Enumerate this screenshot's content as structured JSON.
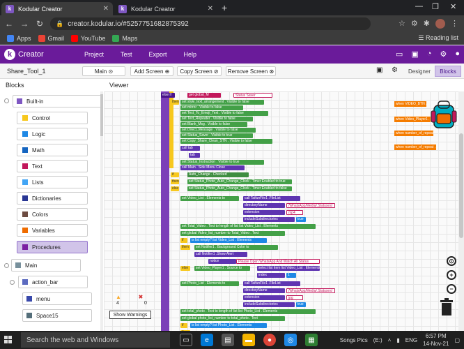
{
  "browser": {
    "tabs": [
      {
        "title": "Kodular Creator",
        "active": true
      },
      {
        "title": "Kodular Creator",
        "active": false
      }
    ],
    "url": "creator.kodular.io/#5257751682875392",
    "bookmarks": [
      {
        "label": "Apps",
        "color": "#4285f4"
      },
      {
        "label": "Gmail",
        "color": "#ea4335"
      },
      {
        "label": "YouTube",
        "color": "#ff0000"
      },
      {
        "label": "Maps",
        "color": "#34a853"
      }
    ],
    "reading_list": "Reading list"
  },
  "kodular": {
    "app_name": "Creator",
    "logo_letter": "k",
    "menu": [
      "Project",
      "Test",
      "Export",
      "Help"
    ],
    "header_color": "#6a1b9a"
  },
  "toolbar": {
    "project_name": "Share_Tool_1",
    "screen_select": "Main",
    "add_screen": "Add Screen",
    "copy_screen": "Copy Screen",
    "remove_screen": "Remove Screen",
    "designer": "Designer",
    "blocks": "Blocks"
  },
  "panels": {
    "blocks_title": "Blocks",
    "viewer_title": "Viewer"
  },
  "sidebar": {
    "builtin_label": "Built-in",
    "builtin": [
      {
        "label": "Control",
        "color": "#f7c81e"
      },
      {
        "label": "Logic",
        "color": "#1e88e5"
      },
      {
        "label": "Math",
        "color": "#1565c0"
      },
      {
        "label": "Text",
        "color": "#c2185b"
      },
      {
        "label": "Lists",
        "color": "#42a5f5"
      },
      {
        "label": "Dictionaries",
        "color": "#283593"
      },
      {
        "label": "Colors",
        "color": "#6d4c41"
      },
      {
        "label": "Variables",
        "color": "#ef6c00"
      },
      {
        "label": "Procedures",
        "color": "#7b1fa2",
        "selected": true
      }
    ],
    "main_label": "Main",
    "action_bar_label": "action_bar",
    "children": [
      {
        "label": "menu"
      },
      {
        "label": "Space15"
      }
    ]
  },
  "workspace": {
    "blocks": [
      {
        "kind": "purple",
        "text": "else if"
      },
      {
        "kind": "txt",
        "text": "get global_M"
      },
      {
        "kind": "val",
        "text": "Status Saver"
      },
      {
        "kind": "ctl",
        "text": "then"
      },
      {
        "kind": "set",
        "text": "set style_text_arrangement . Visible to false"
      },
      {
        "kind": "set",
        "text": "set mirror . Visible to false"
      },
      {
        "kind": "set",
        "text": "set Text_To_Emoji_Text . Visible to false"
      },
      {
        "kind": "set",
        "text": "set Text_Repeater . Visible to false"
      },
      {
        "kind": "set",
        "text": "set Blank_Msg . Visible to false"
      },
      {
        "kind": "set",
        "text": "set Direct_Message . Visible to false"
      },
      {
        "kind": "set",
        "text": "set Status_Saver . Visible to true"
      },
      {
        "kind": "set",
        "text": "set Copy_Share_Clean_STN . Visible to false"
      },
      {
        "kind": "call",
        "text": "call tab"
      },
      {
        "kind": "call",
        "text": "tab"
      },
      {
        "kind": "set",
        "text": "set Status_Instruction . Visible to true"
      },
      {
        "kind": "call",
        "text": "call Main . Side Menu Close"
      },
      {
        "kind": "ctl",
        "text": "if"
      },
      {
        "kind": "comp",
        "text": "Auto_Change . Checked"
      },
      {
        "kind": "ctl",
        "text": "then"
      },
      {
        "kind": "set",
        "text": "set Status_Photo_Auto_Change_Clock . Timer Enabled to true"
      },
      {
        "kind": "ctl",
        "text": "else"
      },
      {
        "kind": "set",
        "text": "set Status_Photo_Auto_Change_Clock . Timer Enabled to false"
      },
      {
        "kind": "set",
        "text": "set Video_List . Elements to"
      },
      {
        "kind": "call",
        "text": "call TaifunFile1 .FileList"
      },
      {
        "kind": "call",
        "text": "directoryName"
      },
      {
        "kind": "val",
        "text": "/WhatsApp/Media/.Statuses/"
      },
      {
        "kind": "call",
        "text": "extension"
      },
      {
        "kind": "val",
        "text": "mp4"
      },
      {
        "kind": "call",
        "text": "includeSubdirectories"
      },
      {
        "kind": "bool",
        "text": "true"
      },
      {
        "kind": "set",
        "text": "set Total_Video . Text to length of list list Video_List . Elements"
      },
      {
        "kind": "set",
        "text": "set global Video_list_number to Total_Video . Text"
      },
      {
        "kind": "ctl",
        "text": "if"
      },
      {
        "kind": "bool",
        "text": "is list empty? list Video_List . Elements"
      },
      {
        "kind": "ctl",
        "text": "then"
      },
      {
        "kind": "set",
        "text": "set Notifier1 . Background Color to"
      },
      {
        "kind": "call",
        "text": "call Notifier1 .Show Alert"
      },
      {
        "kind": "call",
        "text": "notice"
      },
      {
        "kind": "val",
        "text": "Please Open WhatsApp And Watch All Status"
      },
      {
        "kind": "ctl",
        "text": "else"
      },
      {
        "kind": "set",
        "text": "set Video_Player1 . Source to"
      },
      {
        "kind": "call",
        "text": "select list item list Video_List . Elements"
      },
      {
        "kind": "call",
        "text": "index"
      },
      {
        "kind": "bool",
        "text": "1"
      },
      {
        "kind": "set",
        "text": "set Photo_List . Elements to"
      },
      {
        "kind": "call",
        "text": "call TaifunFile1 .FileList"
      },
      {
        "kind": "call",
        "text": "directoryName"
      },
      {
        "kind": "val",
        "text": "/WhatsApp/Media/.Statuses/"
      },
      {
        "kind": "call",
        "text": "extension"
      },
      {
        "kind": "val",
        "text": "jpg"
      },
      {
        "kind": "call",
        "text": "includeSubdirectories"
      },
      {
        "kind": "bool",
        "text": "true"
      },
      {
        "kind": "set",
        "text": "set total_photo . Text to length of list list Photo_List . Elements"
      },
      {
        "kind": "set",
        "text": "set global photo_list_number to total_photo . Text"
      },
      {
        "kind": "ctl",
        "text": "if"
      },
      {
        "kind": "bool",
        "text": "is list empty? list Photo_List . Elements"
      },
      {
        "kind": "ctl",
        "text": "then"
      },
      {
        "kind": "set",
        "text": "set Image1 . Picture to"
      }
    ],
    "orange_events": [
      "when VIDEO_BTN . Click",
      "when Video_Player1 . Completed",
      "when number_of_repeat . Got...",
      "when number_of_repeat . Los..."
    ],
    "warnings": {
      "warning_count": "4",
      "error_count": "0",
      "show_warnings": "Show Warnings"
    }
  },
  "taskbar": {
    "search_placeholder": "Search the web and Windows",
    "tray_label": "Songs Pics",
    "language": "(E:)",
    "lang_code": "ENG",
    "time": "6:57 PM",
    "date": "14-Nov-21"
  }
}
